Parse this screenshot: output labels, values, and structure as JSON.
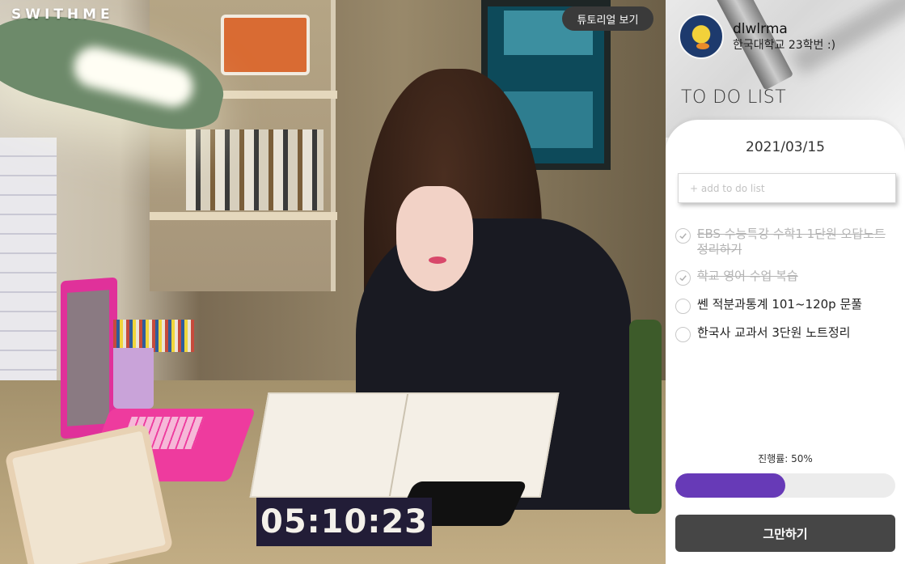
{
  "brand": {
    "logo": "SWITHME"
  },
  "header": {
    "tutorial_button": "튜토리얼 보기"
  },
  "timer": {
    "value": "05:10:23"
  },
  "profile": {
    "avatar": "avatar-image",
    "username": "dlwlrma",
    "bio": "한국대학교 23학번 :)"
  },
  "todo": {
    "title": "TO DO LIST",
    "date": "2021/03/15",
    "input_placeholder": "+ add to do list",
    "items": [
      {
        "text": "EBS 수능특강 수학1 1단원 오답노트 정리하기",
        "done": true
      },
      {
        "text": "학교 영어 수업 복습",
        "done": true
      },
      {
        "text": "쎈 적분과통계 101~120p 문풀",
        "done": false
      },
      {
        "text": "한국사 교과서 3단원 노트정리",
        "done": false
      }
    ],
    "progress_label": "진행률: 50%",
    "progress": 0.5,
    "progress_color": "#673ab7",
    "stop_button": "그만하기"
  },
  "icons": {
    "check": "check-icon"
  }
}
